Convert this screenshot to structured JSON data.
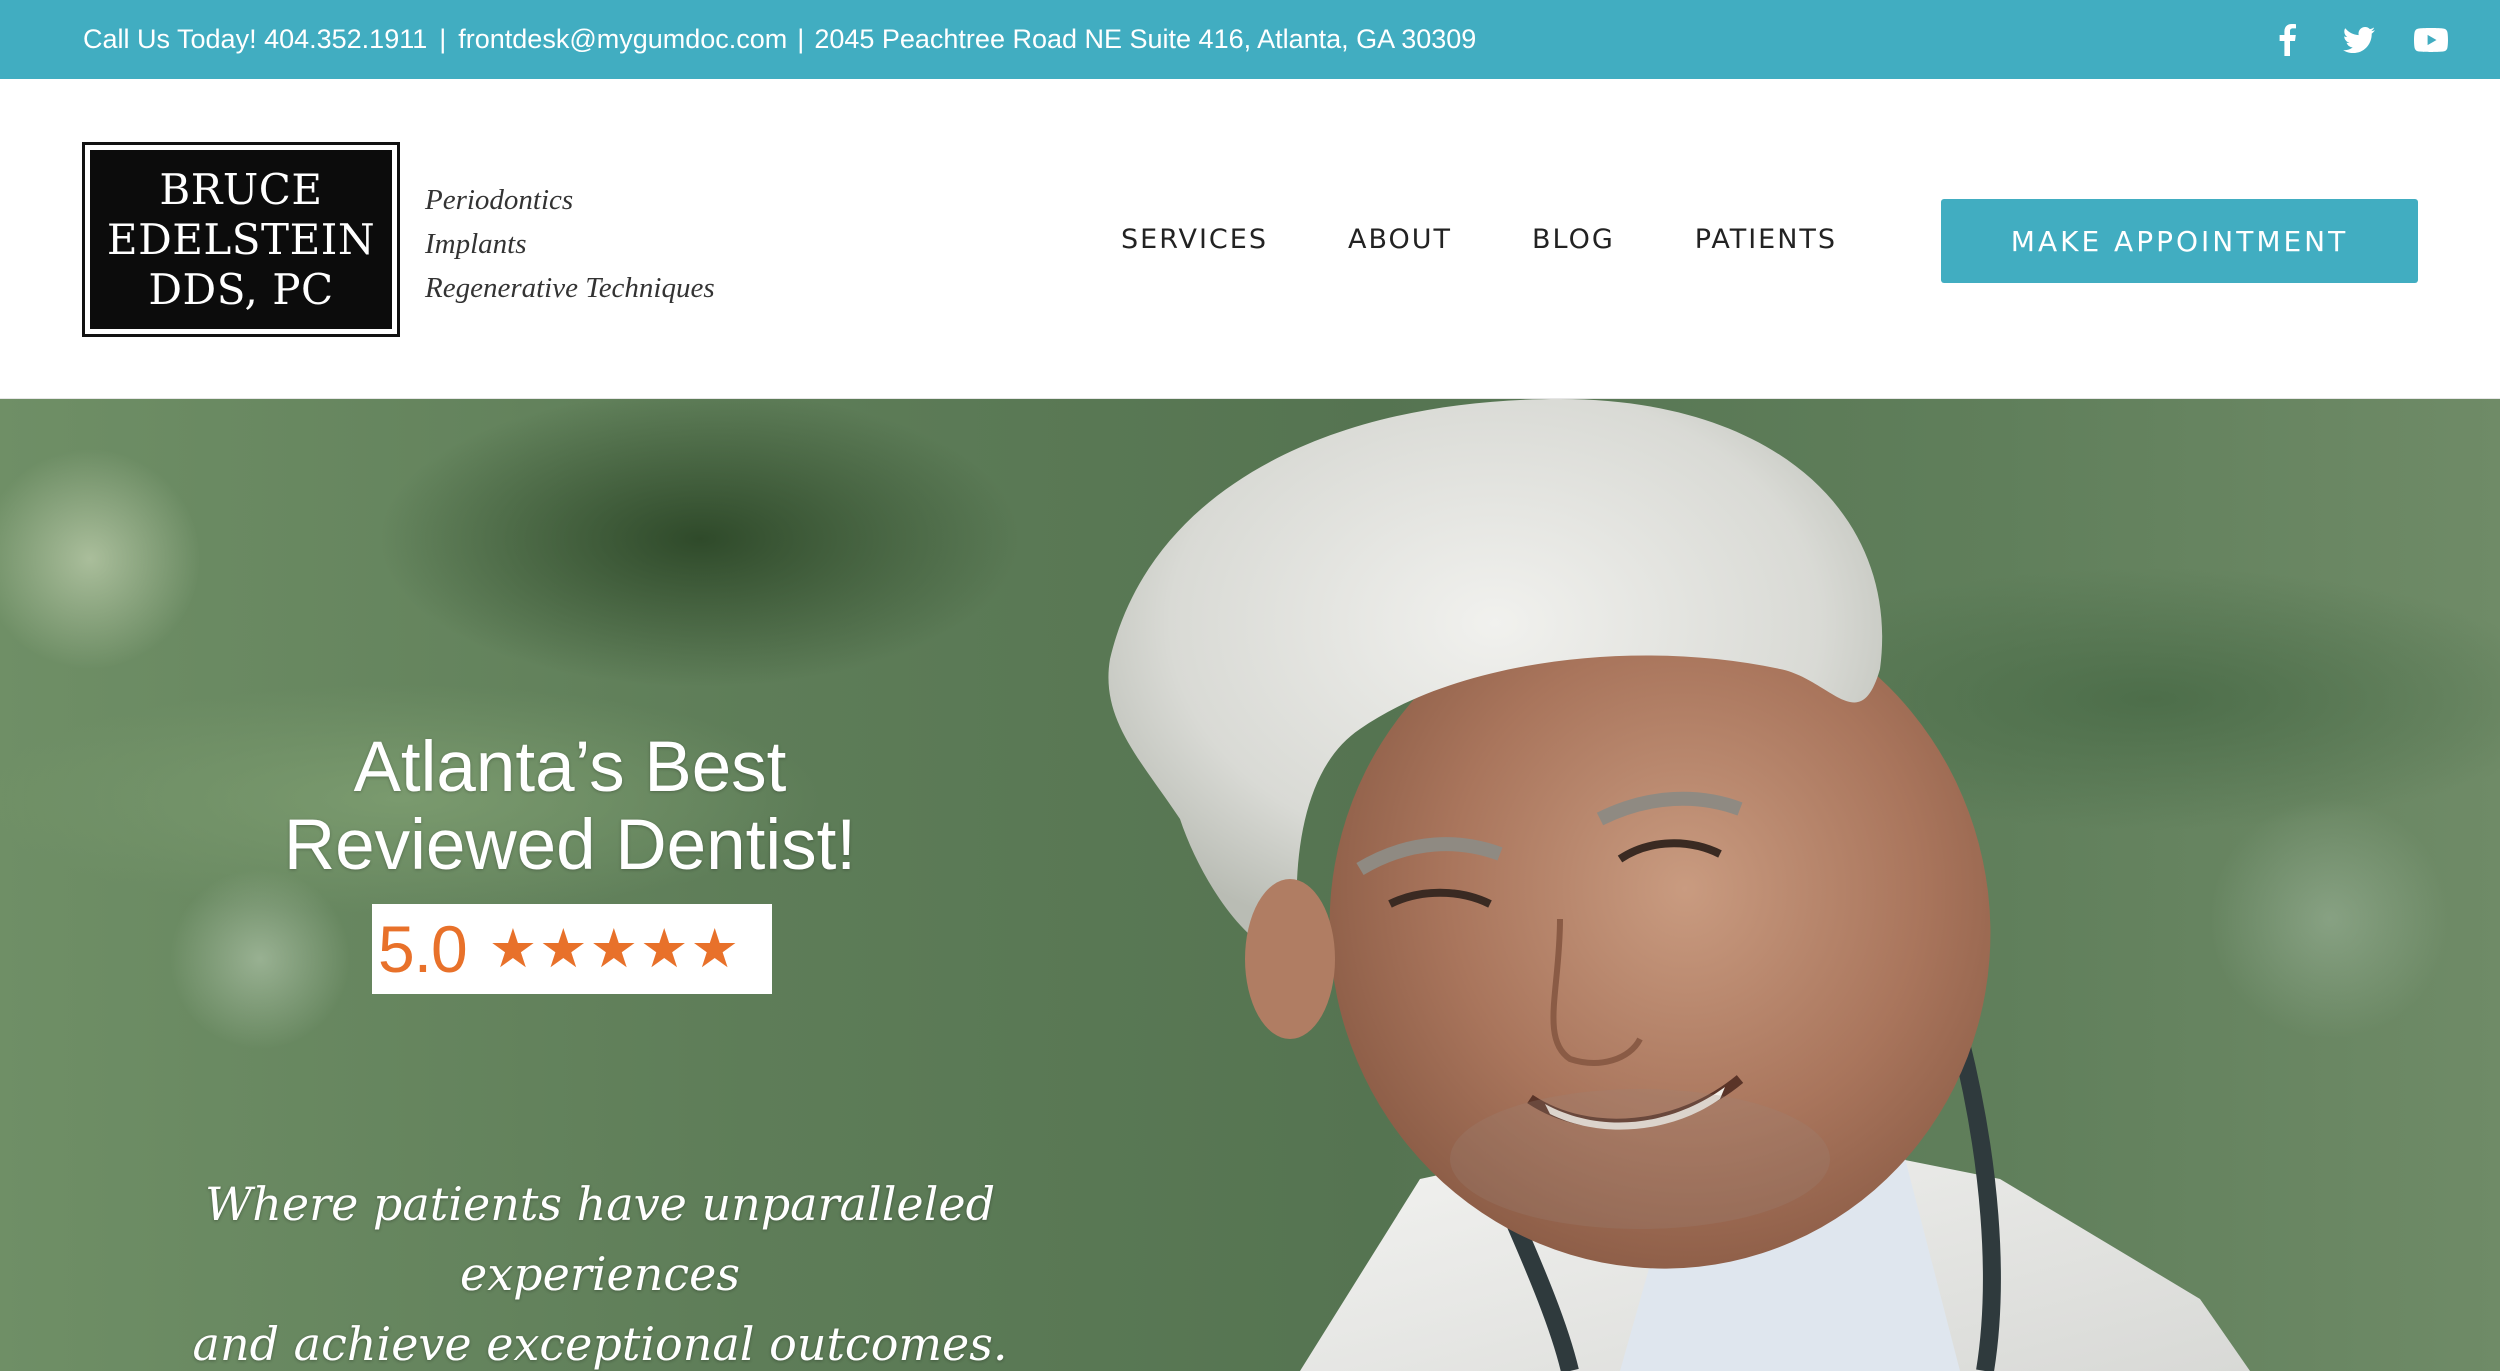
{
  "topbar": {
    "call_text": "Call Us Today! 404.352.1911",
    "separator": "|",
    "email": "frontdesk@mygumdoc.com",
    "separator2": "|",
    "address": "2045 Peachtree Road NE Suite 416, Atlanta, GA 30309",
    "social_icons": [
      "facebook-icon",
      "twitter-icon",
      "youtube-icon"
    ],
    "background_color": "#41adc1"
  },
  "header": {
    "logo": {
      "line1": "BRUCE",
      "line2": "EDELSTEIN",
      "line3": "DDS, PC"
    },
    "tagline": [
      "Periodontics",
      "Implants",
      "Regenerative Techniques"
    ],
    "nav": [
      "SERVICES",
      "ABOUT",
      "BLOG",
      "PATIENTS"
    ],
    "cta_label": "MAKE APPOINTMENT",
    "cta_color": "#41adc1"
  },
  "hero": {
    "title_line1": "Atlanta’s Best",
    "title_line2": "Reviewed Dentist!",
    "rating": {
      "value": "5.0",
      "stars": 5,
      "star_color": "#e8712a"
    },
    "subtitle_line1": "Where patients have unparalleled experiences",
    "subtitle_line2": "and achieve exceptional outcomes."
  }
}
